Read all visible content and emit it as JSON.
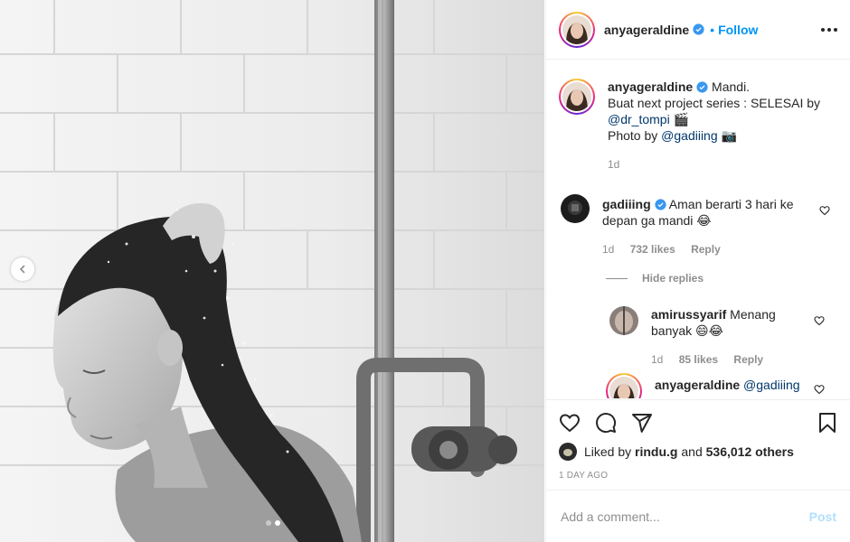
{
  "post": {
    "author": "anyageraldine",
    "follow_label": "Follow",
    "separator": "•",
    "slides_total": 2,
    "slide_active": 2
  },
  "caption": {
    "username": "anyageraldine",
    "line1": "Mandi.",
    "line2": "Buat next project series : SELESAI by",
    "mention1": "@dr_tompi",
    "emoji1": "🎬",
    "line3_prefix": "Photo by",
    "mention2": "@gadiiing",
    "emoji2": "📷",
    "time": "1d"
  },
  "comments": [
    {
      "username": "gadiiing",
      "text": "Aman berarti 3 hari ke depan ga mandi 😂",
      "time": "1d",
      "likes": "732 likes",
      "reply": "Reply"
    }
  ],
  "hide_replies_label": "Hide replies",
  "replies": [
    {
      "username": "amirussyarif",
      "text": "Menang banyak 😄😂",
      "time": "1d",
      "likes": "85 likes",
      "reply": "Reply"
    },
    {
      "username": "anyageraldine",
      "text": "@gadiiing"
    }
  ],
  "likes": {
    "prefix": "Liked by",
    "user": "rindu.g",
    "middle": "and",
    "count": "536,012 others"
  },
  "time_ago": "1 DAY AGO",
  "composer": {
    "placeholder": "Add a comment...",
    "post_label": "Post"
  },
  "colors": {
    "accent": "#0095f6",
    "verified": "#3897f0",
    "post_disabled": "#b2dffc"
  },
  "icons": [
    "chevron-left-icon",
    "verified-badge-icon",
    "more-icon",
    "heart-icon",
    "comment-icon",
    "share-icon",
    "bookmark-icon"
  ]
}
